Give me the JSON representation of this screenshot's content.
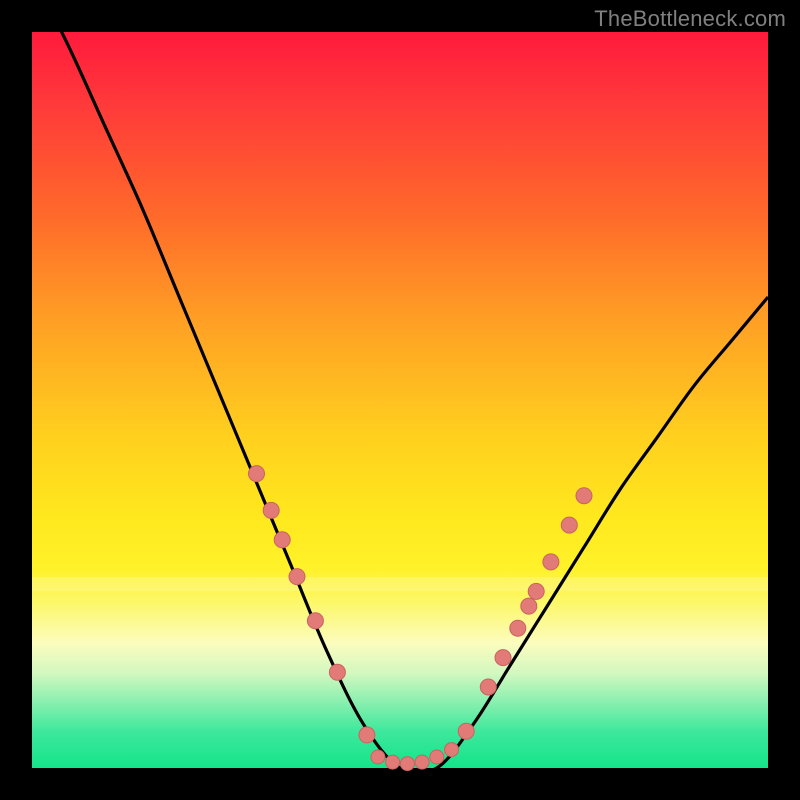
{
  "watermark": "TheBottleneck.com",
  "colors": {
    "background": "#000000",
    "curve": "#000000",
    "marker_fill": "#e27a78",
    "marker_stroke": "#c96360"
  },
  "chart_data": {
    "type": "line",
    "title": "",
    "xlabel": "",
    "ylabel": "",
    "xlim": [
      0,
      100
    ],
    "ylim": [
      0,
      100
    ],
    "grid": false,
    "series": [
      {
        "name": "curve",
        "x": [
          0,
          5,
          10,
          15,
          20,
          25,
          30,
          35,
          40,
          45,
          50,
          55,
          60,
          65,
          70,
          75,
          80,
          85,
          90,
          95,
          100
        ],
        "y": [
          108,
          98,
          87,
          76,
          64,
          52,
          40,
          28,
          16,
          6,
          0,
          0,
          6,
          14,
          22,
          30,
          38,
          45,
          52,
          58,
          64
        ]
      }
    ],
    "markers_left": [
      {
        "x": 30.5,
        "y": 40
      },
      {
        "x": 32.5,
        "y": 35
      },
      {
        "x": 34.0,
        "y": 31
      },
      {
        "x": 36.0,
        "y": 26
      },
      {
        "x": 38.5,
        "y": 20
      },
      {
        "x": 41.5,
        "y": 13
      },
      {
        "x": 45.5,
        "y": 4.5
      }
    ],
    "markers_bottom": [
      {
        "x": 47.0,
        "y": 1.5
      },
      {
        "x": 49.0,
        "y": 0.8
      },
      {
        "x": 51.0,
        "y": 0.6
      },
      {
        "x": 53.0,
        "y": 0.8
      },
      {
        "x": 55.0,
        "y": 1.5
      },
      {
        "x": 57.0,
        "y": 2.5
      }
    ],
    "markers_right": [
      {
        "x": 59.0,
        "y": 5
      },
      {
        "x": 62.0,
        "y": 11
      },
      {
        "x": 64.0,
        "y": 15
      },
      {
        "x": 66.0,
        "y": 19
      },
      {
        "x": 67.5,
        "y": 22
      },
      {
        "x": 68.5,
        "y": 24
      },
      {
        "x": 70.5,
        "y": 28
      },
      {
        "x": 73.0,
        "y": 33
      },
      {
        "x": 75.0,
        "y": 37
      }
    ]
  }
}
